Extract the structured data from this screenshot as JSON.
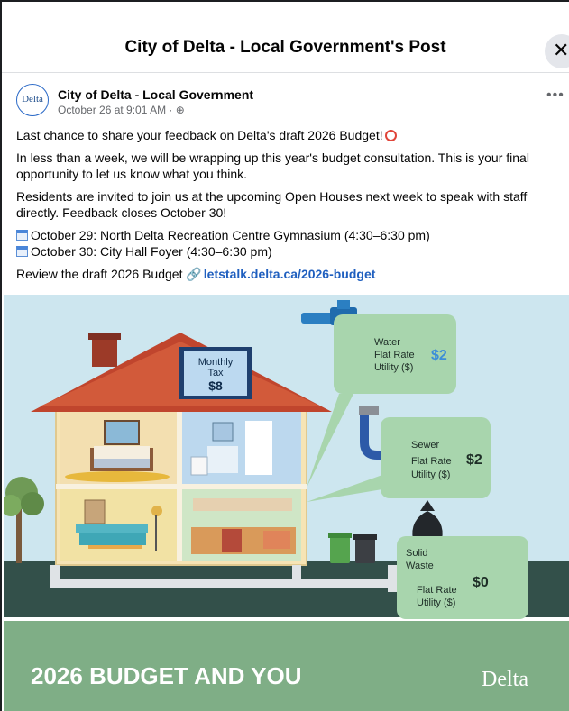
{
  "modal": {
    "title": "City of Delta - Local Government's Post",
    "close_icon": "close-icon"
  },
  "post": {
    "avatar_text": "Delta",
    "author": "City of Delta - Local Government",
    "meta": "October 26 at 9:01 AM · ",
    "more_label": "•••",
    "paragraph1": "Last chance to share your feedback on Delta's draft 2026 Budget!",
    "paragraph2": "In less than a week, we will be wrapping up this year's budget consultation. This is your final opportunity to let us know what you think.",
    "paragraph3": "Residents are invited to join us at the upcoming Open Houses next week to speak with staff directly. Feedback closes October 30!",
    "event1": "October 29: North Delta Recreation Centre Gymnasium (4:30–6:30 pm)",
    "event2": "October 30: City Hall Foyer (4:30–6:30 pm)",
    "review_prefix": "Review the draft 2026 Budget ",
    "link_text": "letstalk.delta.ca/2026-budget"
  },
  "graphic": {
    "monthly_tax_label_1": "Monthly",
    "monthly_tax_label_2": "Tax",
    "monthly_tax_value": "$8",
    "water_label_1": "Water",
    "water_label_2": "Flat Rate",
    "water_label_3": "Utility ($)",
    "water_value": "$2",
    "sewer_label_1": "Sewer",
    "sewer_label_2": "Flat Rate",
    "sewer_label_3": "Utility ($)",
    "sewer_value": "$2",
    "waste_label_1": "Solid",
    "waste_label_2": "Waste",
    "waste_label_3": "Flat Rate",
    "waste_label_4": "Utility ($)",
    "waste_value": "$0",
    "banner_title": "2026 BUDGET AND YOU",
    "banner_logo": "Delta",
    "colors": {
      "sky": "#cde6ef",
      "roof": "#c0452d",
      "wall": "#f4e3b8",
      "callout": "#a8d5ad",
      "value_blue": "#3d8ed8",
      "banner": "#7fae86",
      "ground": "#33504a"
    }
  }
}
